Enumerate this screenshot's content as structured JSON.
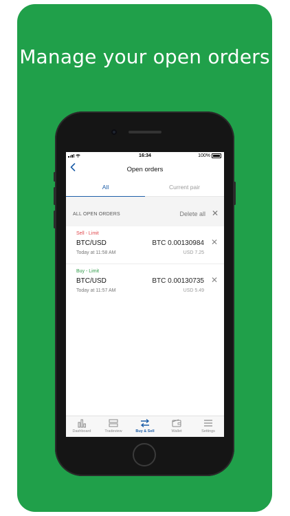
{
  "headline": "Manage your open orders",
  "status_bar": {
    "time": "16:34",
    "battery": "100%"
  },
  "nav": {
    "title": "Open orders",
    "back_icon": "chevron-left-icon"
  },
  "tabs": {
    "all": "All",
    "current_pair": "Current pair",
    "active": "all"
  },
  "orders_section": {
    "title": "ALL OPEN ORDERS",
    "delete_all": "Delete all"
  },
  "orders": [
    {
      "type": "Sell - Limit",
      "type_color": "#e0474c",
      "pair": "BTC/USD",
      "amount": "BTC 0.00130984",
      "time": "Today at 11:58 AM",
      "value": "USD 7.25"
    },
    {
      "type": "Buy - Limit",
      "type_color": "#2e9a48",
      "pair": "BTC/USD",
      "amount": "BTC 0.00130735",
      "time": "Today at 11:57 AM",
      "value": "USD 5.49"
    }
  ],
  "tabbar": [
    {
      "label": "Dashboard",
      "icon": "chart-icon"
    },
    {
      "label": "Tradeview",
      "icon": "tradeview-icon"
    },
    {
      "label": "Buy & Sell",
      "icon": "swap-icon",
      "active": true
    },
    {
      "label": "Wallet",
      "icon": "wallet-icon"
    },
    {
      "label": "Settings",
      "icon": "menu-icon"
    }
  ],
  "colors": {
    "background": "#20a04a",
    "accent": "#1d5ea8",
    "sell": "#e0474c",
    "buy": "#2e9a48"
  }
}
